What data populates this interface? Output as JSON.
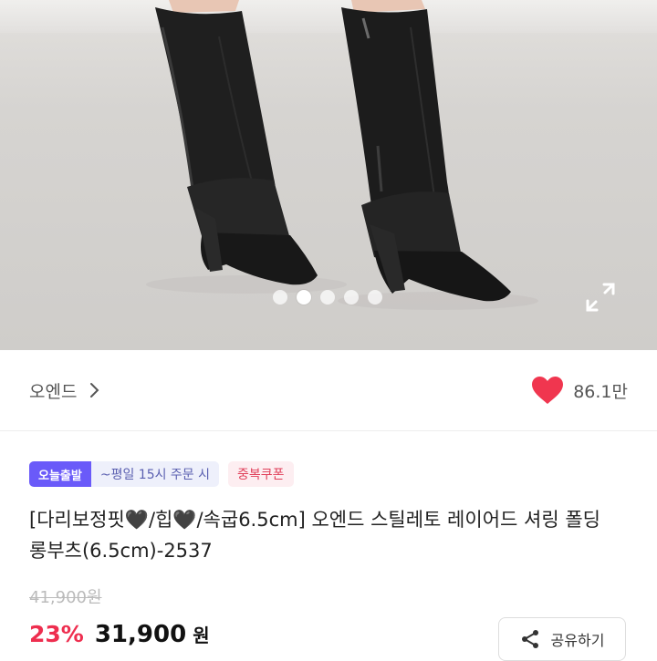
{
  "gallery": {
    "slide_count": 5,
    "active_index": 1,
    "expand_icon": "expand-icon"
  },
  "brand": {
    "name": "오엔드",
    "chevron_icon": "chevron-right-icon"
  },
  "like": {
    "icon": "heart-icon",
    "color": "#f0364f",
    "count": "86.1만"
  },
  "badges": {
    "today_label": "오늘출발",
    "ship_text": "~평일 15시 주문 시",
    "coupon_label": "중복쿠폰"
  },
  "product": {
    "title": "[다리보정핏🖤/힙🖤/속굽6.5cm] 오엔드 스틸레토 레이어드 셔링 폴딩 롱부츠(6.5cm)-2537",
    "original_price": "41,900원",
    "discount": "23%",
    "price": "31,900",
    "currency": "원"
  },
  "share": {
    "label": "공유하기",
    "icon": "share-icon"
  },
  "colors": {
    "accent_red": "#ee2e4f",
    "today_badge": "#6a5af9"
  }
}
